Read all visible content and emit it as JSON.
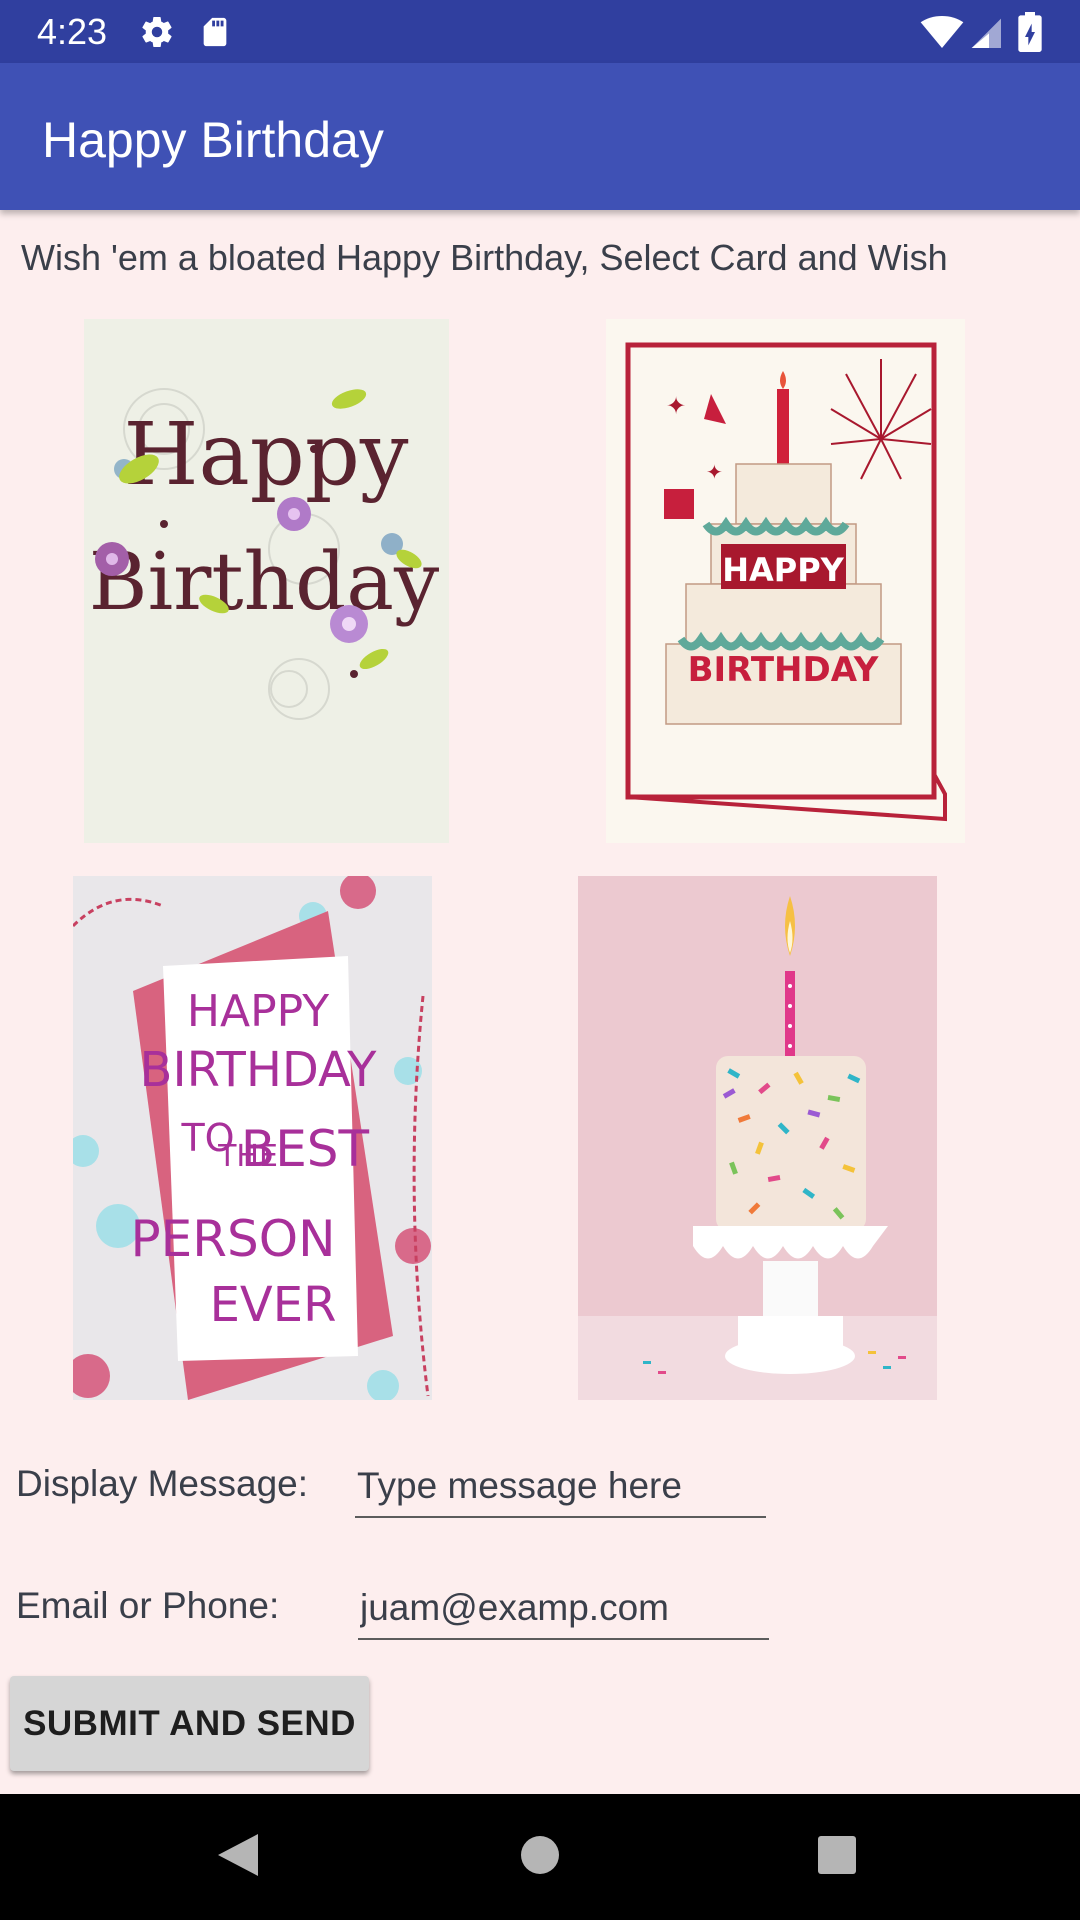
{
  "status_bar": {
    "time": "4:23",
    "icons": [
      "gear-icon",
      "sd-card-icon",
      "wifi-icon",
      "signal-icon",
      "battery-icon"
    ]
  },
  "app_bar": {
    "title": "Happy Birthday"
  },
  "intro_text": "Wish 'em a bloated Happy Birthday, Select Card and Wish",
  "cards": [
    {
      "name": "card-happy-birthday-floral",
      "text_lines": [
        "Happy",
        "Birthday"
      ]
    },
    {
      "name": "card-popup-cake",
      "text_lines": [
        "HAPPY",
        "BIRTHDAY"
      ]
    },
    {
      "name": "card-best-person-ever",
      "text_lines": [
        "HAPPY",
        "BIRTHDAY",
        "TO",
        "THE",
        "BEST",
        "PERSON",
        "EVER"
      ]
    },
    {
      "name": "card-sprinkle-cake",
      "text_lines": []
    }
  ],
  "form": {
    "message_label": "Display Message:",
    "message_value": "",
    "message_placeholder": "Type message here",
    "contact_label": "Email or Phone:",
    "contact_value": "juam@examp.com"
  },
  "submit_label": "SUBMIT AND SEND",
  "nav": {
    "icons": [
      "back-icon",
      "home-icon",
      "recents-icon"
    ]
  },
  "colors": {
    "status_bar": "#303f9f",
    "app_bar": "#3f51b5",
    "background": "#fdeeee"
  }
}
